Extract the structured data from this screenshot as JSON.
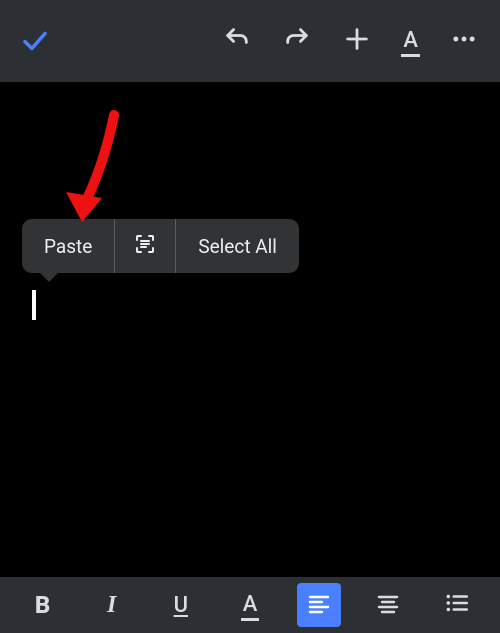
{
  "top": {
    "confirm": "check",
    "undo": "undo",
    "redo": "redo",
    "add": "plus",
    "textformat": "A-underline",
    "more": "more"
  },
  "context_menu": {
    "paste": "Paste",
    "scan": "scan",
    "select_all": "Select All"
  },
  "bottom": {
    "bold": "B",
    "italic": "I",
    "underline": "U",
    "textcolor": "A",
    "align_left": "align-left",
    "align_center": "align-center",
    "list": "list"
  }
}
